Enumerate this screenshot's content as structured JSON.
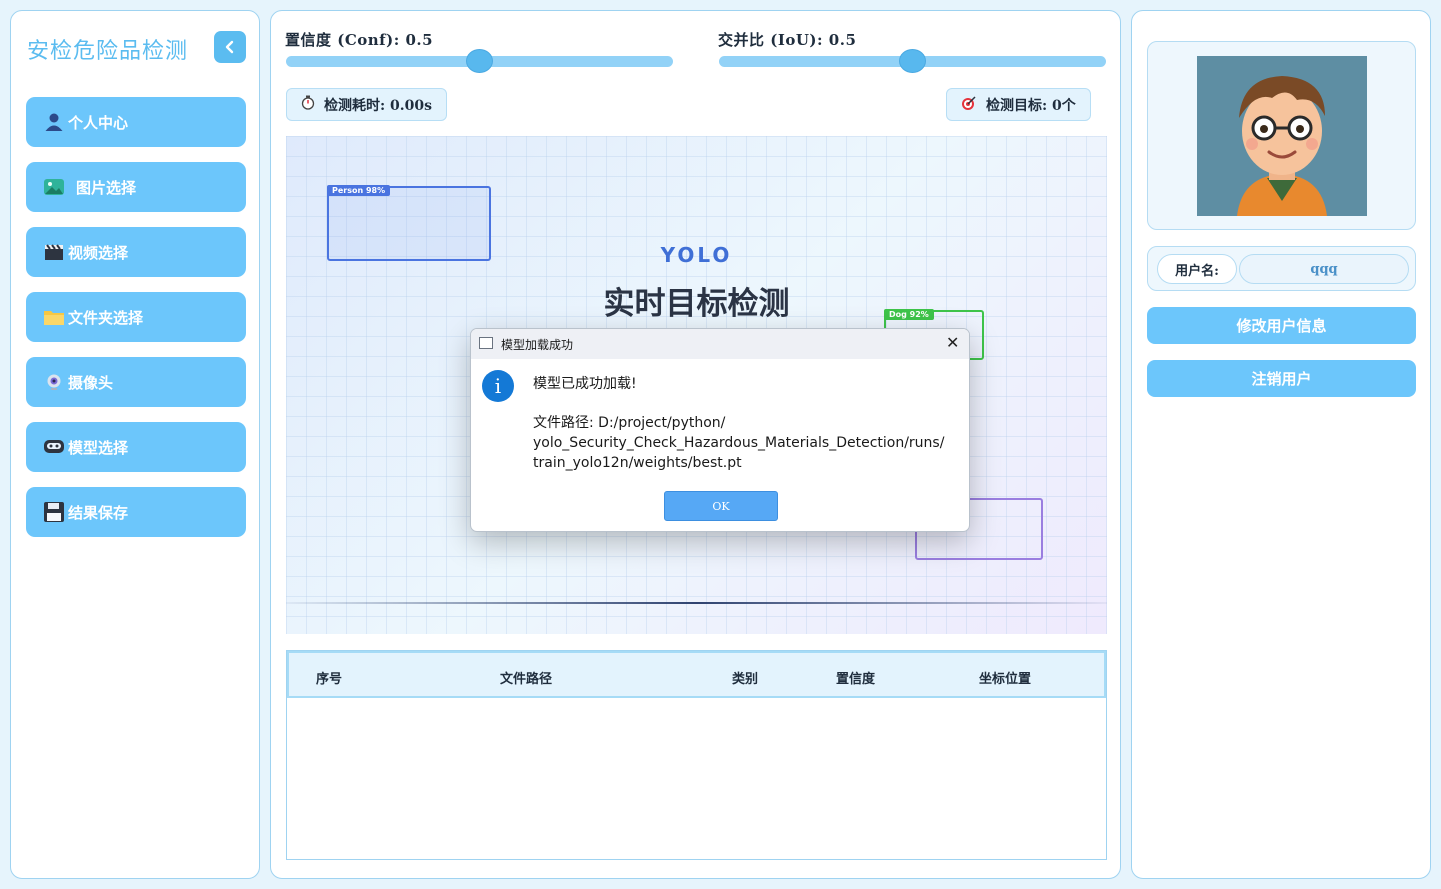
{
  "sidebar": {
    "title": "安检危险品检测",
    "items": [
      {
        "label": "个人中心",
        "icon": "person-icon"
      },
      {
        "label": "图片选择",
        "icon": "image-icon"
      },
      {
        "label": "视频选择",
        "icon": "clapper-icon"
      },
      {
        "label": "文件夹选择",
        "icon": "folder-icon"
      },
      {
        "label": "摄像头",
        "icon": "webcam-icon"
      },
      {
        "label": "模型选择",
        "icon": "model-icon"
      },
      {
        "label": "结果保存",
        "icon": "floppy-icon"
      }
    ]
  },
  "controls": {
    "conf_label": "置信度 (Conf): 0.5",
    "conf_value": 0.5,
    "iou_label": "交并比 (IoU): 0.5",
    "iou_value": 0.5,
    "time_label": "检测耗时: 0.00s",
    "target_label": "检测目标: 0个"
  },
  "preview": {
    "heading": "YOLO",
    "title": "实时目标检测",
    "tags": [
      {
        "label": "Person 98%",
        "color": "#4a74e0"
      },
      {
        "label": "Dog 92%",
        "color": "#3ec44a"
      }
    ],
    "box_colors": {
      "purple": "#9a7ee0"
    }
  },
  "table": {
    "columns": [
      "序号",
      "文件路径",
      "类别",
      "置信度",
      "坐标位置"
    ],
    "rows": []
  },
  "profile": {
    "username_label": "用户名:",
    "username": "qqq",
    "edit_button": "修改用户信息",
    "logout_button": "注销用户"
  },
  "dialog": {
    "title": "模型加载成功",
    "message": "模型已成功加载!",
    "path_line1": "文件路径: D:/project/python/",
    "path_line2": "yolo_Security_Check_Hazardous_Materials_Detection/runs/",
    "path_line3": "train_yolo12n/weights/best.pt",
    "ok_button": "OK"
  },
  "colors": {
    "accent": "#6cc6fb",
    "accent_dark": "#58b8ee",
    "background": "#e6f4fc"
  }
}
